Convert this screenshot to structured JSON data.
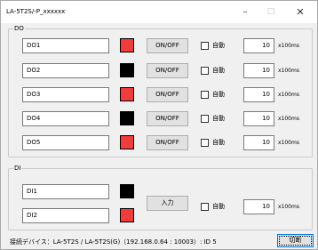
{
  "window": {
    "title": "LA-5T2S/-P_xxxxxx",
    "minimize_glyph": "–",
    "maximize_glyph": "□",
    "close_glyph": "✕"
  },
  "do_group": {
    "label": "DO",
    "rows": [
      {
        "name": "DO1",
        "state_color": "red",
        "button_label": "ON/OFF",
        "auto_label": "自動",
        "auto_checked": false,
        "interval": "10",
        "unit": "x100ms"
      },
      {
        "name": "DO2",
        "state_color": "black",
        "button_label": "ON/OFF",
        "auto_label": "自動",
        "auto_checked": false,
        "interval": "10",
        "unit": "x100ms"
      },
      {
        "name": "DO3",
        "state_color": "red",
        "button_label": "ON/OFF",
        "auto_label": "自動",
        "auto_checked": false,
        "interval": "10",
        "unit": "x100ms"
      },
      {
        "name": "DO4",
        "state_color": "black",
        "button_label": "ON/OFF",
        "auto_label": "自動",
        "auto_checked": false,
        "interval": "10",
        "unit": "x100ms"
      },
      {
        "name": "DO5",
        "state_color": "red",
        "button_label": "ON/OFF",
        "auto_label": "自動",
        "auto_checked": false,
        "interval": "10",
        "unit": "x100ms"
      }
    ]
  },
  "di_group": {
    "label": "DI",
    "inputs": [
      {
        "name": "DI1",
        "state_color": "black"
      },
      {
        "name": "DI2",
        "state_color": "red"
      }
    ],
    "read_button": "入力",
    "auto_label": "自動",
    "auto_checked": false,
    "interval": "10",
    "unit": "x100ms"
  },
  "status": {
    "text": "接続デバイス：LA-5T2S / LA-5T2S(G)（192.168.0.64 : 10003）: ID 5"
  },
  "disconnect_button": "切断",
  "colors": {
    "red": "#f03c3c",
    "black": "#000000"
  }
}
